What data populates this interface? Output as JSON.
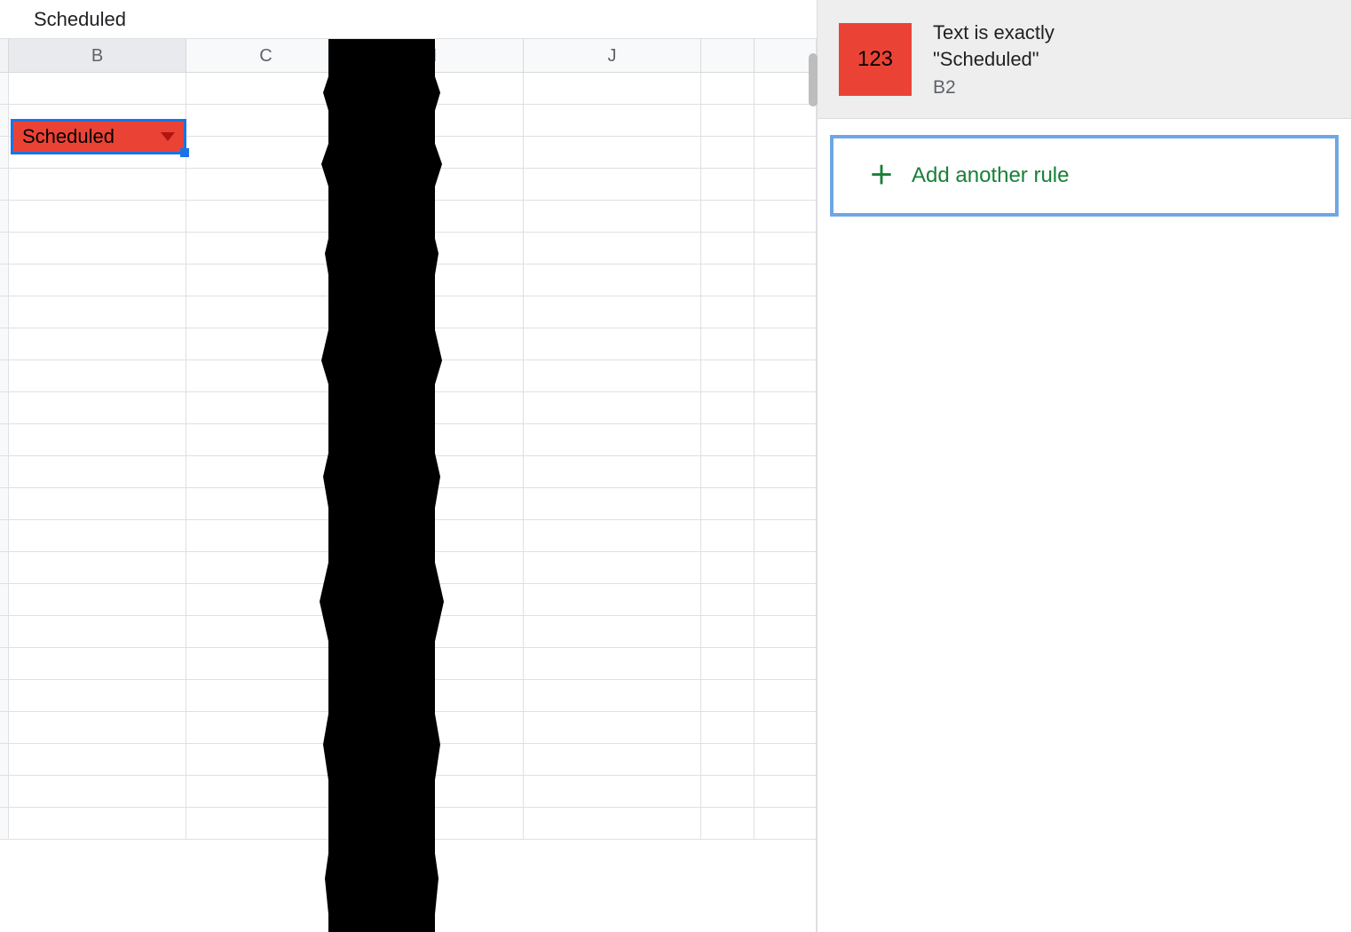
{
  "formula_bar": {
    "text": "Scheduled"
  },
  "columns": [
    "B",
    "C",
    "I",
    "J"
  ],
  "activeCell": {
    "value": "Scheduled",
    "ref": "B2",
    "fill": "#ea4335",
    "selectionBorder": "#1a73e8"
  },
  "sidepanel": {
    "rule": {
      "swatch_text": "123",
      "swatch_color": "#ea4335",
      "title_line1": "Text is exactly",
      "title_line2": "\"Scheduled\"",
      "range": "B2"
    },
    "add_rule_label": "Add another rule"
  }
}
